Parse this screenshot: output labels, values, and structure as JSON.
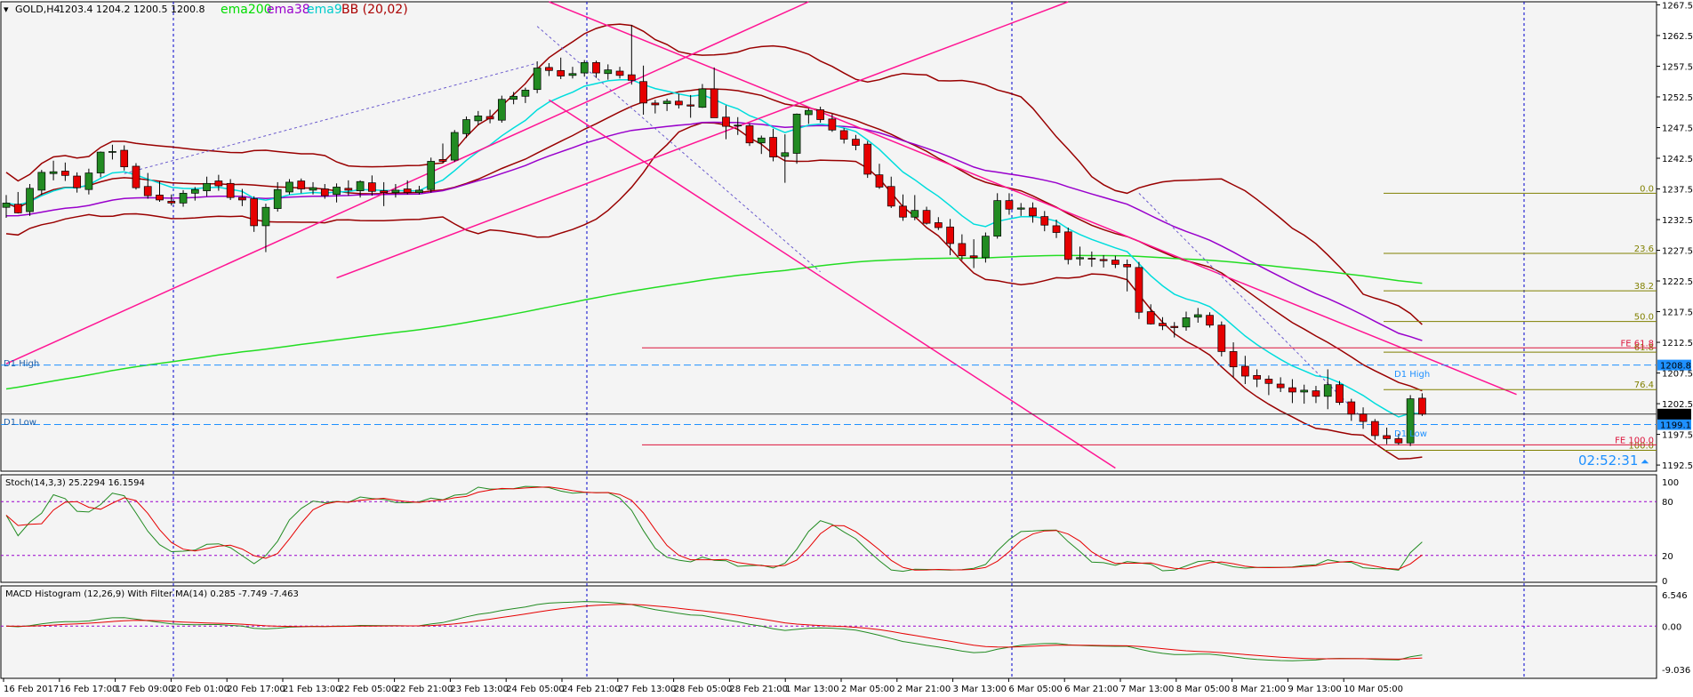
{
  "header": {
    "symbol_label": "GOLD,H4",
    "ohlc_label": "1203.4 1204.2 1200.5 1200.8",
    "indicators": [
      {
        "label": "ema200",
        "color": "#00dd00"
      },
      {
        "label": "ema38",
        "color": "#9900cc"
      },
      {
        "label": "ema9",
        "color": "#00dddd"
      },
      {
        "label": "BB (20,02)",
        "color": "#aa0000"
      }
    ]
  },
  "colors": {
    "background": "#f4f4f4",
    "bull": "#228b22",
    "bear": "#e60000",
    "channel": "#ff1493",
    "bb": "#990000",
    "ema200": "#22dd22",
    "ema38": "#9900cc",
    "ema9": "#00dddd",
    "fib": "#808000",
    "fe": "#dc143c",
    "dline": "#1e90ff",
    "grid": "#0000cc"
  },
  "price_axis": {
    "ticks": [
      "1267.5",
      "1262.5",
      "1257.5",
      "1252.5",
      "1247.5",
      "1242.5",
      "1237.5",
      "1232.5",
      "1227.5",
      "1222.5",
      "1217.5",
      "1212.5",
      "1207.5",
      "1202.5",
      "1197.5",
      "1192.5"
    ],
    "ylim": [
      1191.5,
      1268.0
    ],
    "current_price": "1200.8",
    "d1_low_price": "1199.1",
    "d1_high_price": "1208.8"
  },
  "time_axis": {
    "labels": [
      "16 Feb 2017",
      "16 Feb 17:00",
      "17 Feb 09:00",
      "20 Feb 01:00",
      "20 Feb 17:00",
      "21 Feb 13:00",
      "22 Feb 05:00",
      "22 Feb 21:00",
      "23 Feb 13:00",
      "24 Feb 05:00",
      "24 Feb 21:00",
      "27 Feb 13:00",
      "28 Feb 05:00",
      "28 Feb 21:00",
      "1 Mar 13:00",
      "2 Mar 05:00",
      "2 Mar 21:00",
      "3 Mar 13:00",
      "6 Mar 05:00",
      "6 Mar 21:00",
      "7 Mar 13:00",
      "8 Mar 05:00",
      "8 Mar 21:00",
      "9 Mar 13:00",
      "10 Mar 05:00"
    ]
  },
  "levels": {
    "d1_high_label": "D1 High",
    "d1_low_label": "D1 Low",
    "fib": [
      {
        "label": "0.0",
        "price": 1236.8
      },
      {
        "label": "23.6",
        "price": 1227.0
      },
      {
        "label": "38.2",
        "price": 1220.9
      },
      {
        "label": "50.0",
        "price": 1215.9
      },
      {
        "label": "61.8",
        "price": 1210.9
      },
      {
        "label": "76.4",
        "price": 1204.8
      },
      {
        "label": "100.0",
        "price": 1194.9
      }
    ],
    "fe": [
      {
        "label": "FE 61.8",
        "price": 1211.6
      },
      {
        "label": "FE 100.0",
        "price": 1195.8
      }
    ]
  },
  "countdown": "02:52:31",
  "stoch": {
    "label": "Stoch(14,3,3) 25.2294 16.1594",
    "ticks": [
      "100",
      "80",
      "20",
      "0"
    ]
  },
  "macd": {
    "label": "MACD Histogram (12,26,9) With Filter MA(14) 0.285 -7.749 -7.463",
    "ticks": [
      "6.546",
      "0.00",
      "-9.036"
    ]
  },
  "chart_data": {
    "type": "candlestick",
    "symbol": "GOLD",
    "timeframe": "H4",
    "title": "GOLD,H4",
    "candles": [
      [
        1234.5,
        1236.5,
        1232.8,
        1235.2
      ],
      [
        1235.0,
        1237.0,
        1233.5,
        1233.6
      ],
      [
        1233.8,
        1238.3,
        1233.1,
        1237.6
      ],
      [
        1237.3,
        1240.6,
        1236.5,
        1240.2
      ],
      [
        1240.0,
        1242.1,
        1238.9,
        1240.3
      ],
      [
        1240.4,
        1241.8,
        1238.8,
        1239.7
      ],
      [
        1239.6,
        1240.2,
        1236.9,
        1237.7
      ],
      [
        1237.4,
        1240.8,
        1236.6,
        1240.1
      ],
      [
        1240.1,
        1243.6,
        1239.4,
        1243.5
      ],
      [
        1243.5,
        1244.7,
        1242.3,
        1243.6
      ],
      [
        1243.8,
        1244.6,
        1240.5,
        1241.1
      ],
      [
        1241.2,
        1241.7,
        1237.4,
        1237.7
      ],
      [
        1237.9,
        1240.1,
        1235.9,
        1236.4
      ],
      [
        1236.5,
        1238.7,
        1235.4,
        1235.7
      ],
      [
        1235.5,
        1236.6,
        1234.8,
        1235.2
      ],
      [
        1235.2,
        1237.3,
        1234.6,
        1236.8
      ],
      [
        1236.8,
        1237.8,
        1235.6,
        1237.4
      ],
      [
        1237.2,
        1239.5,
        1236.3,
        1238.4
      ],
      [
        1238.8,
        1239.8,
        1237.2,
        1238.0
      ],
      [
        1238.4,
        1239.1,
        1235.7,
        1236.1
      ],
      [
        1236.1,
        1237.5,
        1234.7,
        1235.7
      ],
      [
        1235.9,
        1236.3,
        1230.5,
        1231.5
      ],
      [
        1231.5,
        1235.1,
        1227.2,
        1234.5
      ],
      [
        1234.3,
        1238.6,
        1233.8,
        1237.4
      ],
      [
        1237.0,
        1239.1,
        1236.6,
        1238.6
      ],
      [
        1238.8,
        1239.2,
        1236.8,
        1237.5
      ],
      [
        1237.3,
        1238.6,
        1236.6,
        1237.7
      ],
      [
        1237.5,
        1238.3,
        1235.9,
        1236.4
      ],
      [
        1236.6,
        1238.4,
        1235.3,
        1237.8
      ],
      [
        1237.6,
        1238.9,
        1236.4,
        1237.3
      ],
      [
        1237.2,
        1238.9,
        1236.1,
        1238.7
      ],
      [
        1238.5,
        1239.7,
        1236.4,
        1237.1
      ],
      [
        1237.2,
        1238.6,
        1234.7,
        1236.9
      ],
      [
        1236.9,
        1238.3,
        1236.1,
        1237.3
      ],
      [
        1237.5,
        1238.9,
        1236.6,
        1236.9
      ],
      [
        1236.9,
        1238.0,
        1236.6,
        1237.3
      ],
      [
        1237.4,
        1242.6,
        1236.9,
        1242.0
      ],
      [
        1242.3,
        1244.9,
        1241.8,
        1242.0
      ],
      [
        1242.2,
        1247.1,
        1241.9,
        1246.7
      ],
      [
        1246.5,
        1249.3,
        1245.8,
        1248.8
      ],
      [
        1248.6,
        1250.2,
        1247.9,
        1249.4
      ],
      [
        1249.3,
        1250.4,
        1248.2,
        1248.9
      ],
      [
        1248.7,
        1252.7,
        1248.3,
        1252.1
      ],
      [
        1252.1,
        1253.3,
        1251.3,
        1252.6
      ],
      [
        1252.6,
        1254.0,
        1251.5,
        1253.6
      ],
      [
        1253.7,
        1258.3,
        1253.1,
        1257.2
      ],
      [
        1257.3,
        1258.0,
        1255.9,
        1256.8
      ],
      [
        1256.8,
        1258.9,
        1255.4,
        1255.9
      ],
      [
        1256.0,
        1257.4,
        1255.5,
        1256.3
      ],
      [
        1256.4,
        1258.5,
        1255.8,
        1258.1
      ],
      [
        1258.1,
        1258.4,
        1255.6,
        1256.4
      ],
      [
        1256.3,
        1257.8,
        1255.3,
        1256.9
      ],
      [
        1256.7,
        1257.4,
        1255.5,
        1256.0
      ],
      [
        1256.1,
        1264.2,
        1254.5,
        1255.2
      ],
      [
        1255.0,
        1257.6,
        1249.6,
        1251.5
      ],
      [
        1251.5,
        1252.0,
        1249.8,
        1251.2
      ],
      [
        1251.4,
        1252.2,
        1250.2,
        1251.8
      ],
      [
        1251.8,
        1253.0,
        1250.6,
        1251.2
      ],
      [
        1251.2,
        1252.8,
        1249.1,
        1251.0
      ],
      [
        1250.8,
        1254.6,
        1250.7,
        1253.8
      ],
      [
        1253.8,
        1257.3,
        1251.6,
        1249.1
      ],
      [
        1249.2,
        1251.1,
        1245.6,
        1247.7
      ],
      [
        1247.8,
        1249.2,
        1246.3,
        1247.9
      ],
      [
        1247.8,
        1248.2,
        1244.5,
        1245.0
      ],
      [
        1245.0,
        1246.2,
        1243.2,
        1245.8
      ],
      [
        1245.9,
        1247.3,
        1242.0,
        1242.7
      ],
      [
        1242.8,
        1246.4,
        1238.5,
        1243.4
      ],
      [
        1243.3,
        1249.8,
        1241.6,
        1249.7
      ],
      [
        1249.6,
        1250.6,
        1248.1,
        1250.3
      ],
      [
        1250.4,
        1250.9,
        1248.3,
        1248.8
      ],
      [
        1248.9,
        1249.7,
        1246.8,
        1247.1
      ],
      [
        1247.0,
        1247.4,
        1244.9,
        1245.6
      ],
      [
        1245.6,
        1246.3,
        1243.8,
        1244.6
      ],
      [
        1244.8,
        1245.3,
        1239.3,
        1239.9
      ],
      [
        1239.8,
        1241.6,
        1237.5,
        1237.8
      ],
      [
        1237.9,
        1239.5,
        1234.4,
        1234.7
      ],
      [
        1234.7,
        1236.6,
        1232.3,
        1232.9
      ],
      [
        1232.9,
        1236.5,
        1232.4,
        1234.0
      ],
      [
        1234.0,
        1234.6,
        1231.7,
        1231.9
      ],
      [
        1232.0,
        1232.9,
        1230.8,
        1231.2
      ],
      [
        1231.3,
        1232.6,
        1226.7,
        1228.6
      ],
      [
        1228.6,
        1230.1,
        1225.9,
        1226.6
      ],
      [
        1226.6,
        1229.3,
        1224.6,
        1226.3
      ],
      [
        1226.3,
        1230.4,
        1225.5,
        1229.8
      ],
      [
        1229.8,
        1236.8,
        1229.4,
        1235.6
      ],
      [
        1235.6,
        1236.8,
        1233.3,
        1234.2
      ],
      [
        1234.2,
        1235.2,
        1233.1,
        1234.4
      ],
      [
        1234.4,
        1235.3,
        1232.0,
        1233.1
      ],
      [
        1233.0,
        1233.9,
        1230.6,
        1231.6
      ],
      [
        1231.5,
        1232.5,
        1229.5,
        1230.4
      ],
      [
        1230.5,
        1231.2,
        1225.2,
        1226.0
      ],
      [
        1226.1,
        1228.1,
        1225.0,
        1226.3
      ],
      [
        1226.2,
        1227.3,
        1224.8,
        1226.1
      ],
      [
        1226.0,
        1226.7,
        1224.7,
        1225.8
      ],
      [
        1225.9,
        1226.6,
        1224.6,
        1225.2
      ],
      [
        1225.2,
        1226.0,
        1220.8,
        1224.8
      ],
      [
        1224.7,
        1225.6,
        1216.3,
        1217.4
      ],
      [
        1217.5,
        1218.7,
        1215.4,
        1215.5
      ],
      [
        1215.6,
        1216.6,
        1214.5,
        1215.2
      ],
      [
        1215.1,
        1215.8,
        1213.3,
        1214.9
      ],
      [
        1215.0,
        1217.5,
        1214.4,
        1216.5
      ],
      [
        1216.6,
        1218.1,
        1215.7,
        1217.0
      ],
      [
        1216.9,
        1217.4,
        1214.9,
        1215.3
      ],
      [
        1215.3,
        1215.9,
        1210.2,
        1211.0
      ],
      [
        1211.0,
        1212.5,
        1206.8,
        1208.5
      ],
      [
        1208.6,
        1210.3,
        1205.7,
        1207.0
      ],
      [
        1207.1,
        1208.1,
        1205.2,
        1206.5
      ],
      [
        1206.5,
        1207.1,
        1203.9,
        1205.8
      ],
      [
        1205.7,
        1206.8,
        1204.4,
        1205.1
      ],
      [
        1205.1,
        1206.5,
        1202.6,
        1204.4
      ],
      [
        1204.4,
        1205.6,
        1202.5,
        1204.7
      ],
      [
        1204.6,
        1205.4,
        1202.6,
        1203.7
      ],
      [
        1203.7,
        1208.1,
        1201.6,
        1205.6
      ],
      [
        1205.6,
        1206.2,
        1202.3,
        1202.7
      ],
      [
        1202.8,
        1203.3,
        1199.7,
        1200.8
      ],
      [
        1200.8,
        1201.9,
        1198.4,
        1199.6
      ],
      [
        1199.6,
        1200.0,
        1196.6,
        1197.3
      ],
      [
        1197.3,
        1198.6,
        1195.9,
        1196.8
      ],
      [
        1196.8,
        1197.6,
        1195.8,
        1196.1
      ],
      [
        1196.1,
        1203.9,
        1195.6,
        1203.3
      ],
      [
        1203.4,
        1204.2,
        1200.5,
        1200.8
      ]
    ]
  }
}
